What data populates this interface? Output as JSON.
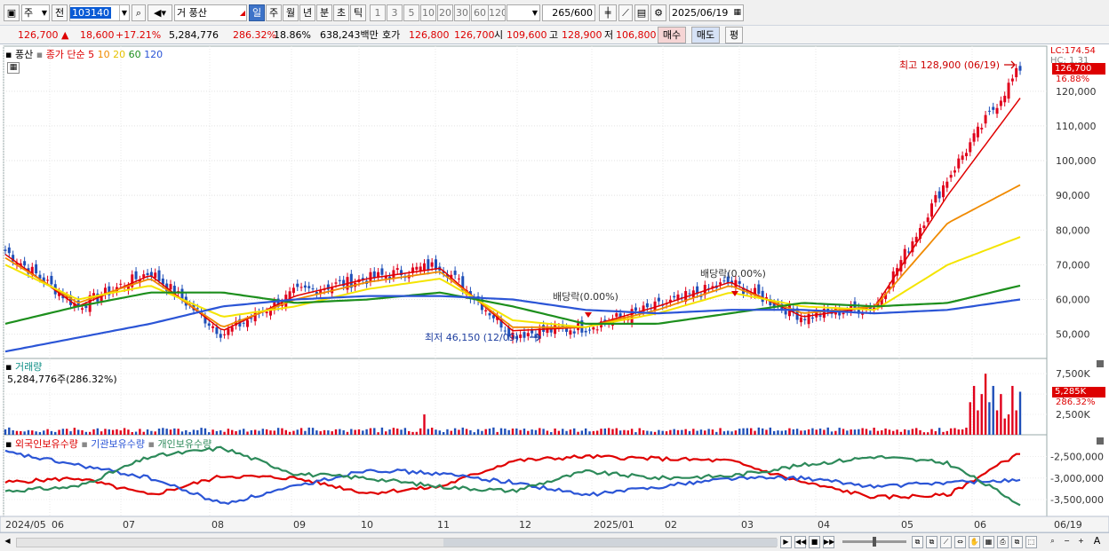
{
  "toolbar": {
    "market": "주",
    "prefix": "전",
    "code": "103140",
    "stock_name": "풍산",
    "periods": [
      "일",
      "주",
      "월",
      "년",
      "분",
      "초",
      "틱"
    ],
    "active_period": "일",
    "minutes": [
      "1",
      "3",
      "5",
      "10",
      "20",
      "30",
      "60",
      "120"
    ],
    "count": "265",
    "count_total": "/600",
    "date": "2025/06/19"
  },
  "quote": {
    "price": "126,700",
    "change": "18,600",
    "change_pct": "+17.21%",
    "volume": "5,284,776",
    "volume_pct": "286.32%",
    "turnover": "18.86%",
    "amount": "638,243백만",
    "ask_label": "호가",
    "ask": "126,800",
    "bid": "126,700",
    "open_label": "시",
    "open": "109,600",
    "high_label": "고",
    "high": "128,900",
    "low_label": "저",
    "low": "106,800",
    "buy_label": "매수",
    "sell_label": "매도",
    "eval_label": "평"
  },
  "legend": {
    "name": "풍산",
    "title": "종가 단순",
    "ma5": "5",
    "ma10": "10",
    "ma20": "20",
    "ma60": "60",
    "ma120": "120"
  },
  "colors": {
    "up": "#e0001b",
    "down": "#1f4fb8",
    "ma5": "#e00000",
    "ma10": "#f08a00",
    "ma20": "#f4e400",
    "ma60": "#1d8f1d",
    "ma120": "#2b55d6",
    "foreign": "#e00000",
    "inst": "#2b55d6",
    "indiv": "#2d8a5a"
  },
  "price_panel": {
    "lc": "LC:174.54",
    "hc": "HC: 1.31",
    "current_tag": "126,700",
    "current_pct": "16.88%",
    "high_note": "최고 128,900 (06/19)",
    "low_note": "최저 46,150 (12/09)",
    "div1": "배당락(0.00%)",
    "div2": "배당락(0.00%)"
  },
  "volume_panel": {
    "title": "거래량",
    "value": "5,284,776주(286.32%)",
    "tag": "5,285K",
    "tag_pct": "286.32%"
  },
  "holdings_panel": {
    "foreign": "외국인보유수량",
    "inst": "기관보유수량",
    "indiv": "개인보유수량"
  },
  "x_labels": [
    "2024/05",
    "06",
    "07",
    "08",
    "09",
    "10",
    "11",
    "12",
    "2025/01",
    "02",
    "03",
    "04",
    "05",
    "06",
    "06/19"
  ],
  "chart_data": [
    {
      "type": "line",
      "title": "풍산 종가 단순 이동평균",
      "x": [
        "2024/05",
        "06",
        "07",
        "08",
        "09",
        "10",
        "11",
        "12",
        "2025/01",
        "02",
        "03",
        "04",
        "05",
        "06",
        "06/19"
      ],
      "series": [
        {
          "name": "종가",
          "values": [
            74000,
            58000,
            68000,
            50000,
            62000,
            66000,
            70000,
            50000,
            52000,
            58000,
            65000,
            55000,
            58000,
            95000,
            126700
          ]
        },
        {
          "name": "5",
          "values": [
            73000,
            58000,
            67000,
            51000,
            61000,
            66000,
            69000,
            51000,
            52000,
            58000,
            65000,
            55000,
            58000,
            90000,
            118000
          ]
        },
        {
          "name": "10",
          "values": [
            72000,
            59000,
            66000,
            52000,
            60000,
            65000,
            68000,
            52000,
            52000,
            57000,
            64000,
            56000,
            58000,
            82000,
            93000
          ]
        },
        {
          "name": "20",
          "values": [
            70000,
            60000,
            64000,
            55000,
            58000,
            63000,
            66000,
            54000,
            52000,
            56000,
            62000,
            58000,
            57000,
            70000,
            78000
          ]
        },
        {
          "name": "60",
          "values": [
            53000,
            58000,
            62000,
            62000,
            59000,
            60000,
            62000,
            58000,
            53000,
            53000,
            56000,
            59000,
            58000,
            59000,
            64000
          ]
        },
        {
          "name": "120",
          "values": [
            45000,
            49000,
            53000,
            58000,
            60000,
            61000,
            61000,
            60000,
            57000,
            56000,
            57000,
            57000,
            56000,
            57000,
            60000
          ]
        }
      ],
      "ylim": [
        43000,
        128900
      ],
      "yticks": [
        "120,000",
        "110,000",
        "100,000",
        "90,000",
        "80,000",
        "70,000",
        "60,000",
        "50,000"
      ]
    },
    {
      "type": "bar",
      "title": "거래량",
      "yticks": [
        "7,500K",
        "5,000K",
        "2,500K"
      ],
      "ylim": [
        0,
        8500000
      ]
    },
    {
      "type": "line",
      "title": "보유수량",
      "series": [
        {
          "name": "외국인보유수량",
          "values": [
            -3100000,
            -3000000,
            -3400000,
            -2950000,
            -3000000,
            -3350000,
            -3200000,
            -2600000,
            -2500000,
            -2550000,
            -2600000,
            -3100000,
            -3450000,
            -3400000,
            -2400000
          ]
        },
        {
          "name": "기관보유수량",
          "values": [
            -2400000,
            -2700000,
            -3000000,
            -3600000,
            -3200000,
            -2800000,
            -2900000,
            -3100000,
            -3400000,
            -3200000,
            -3000000,
            -3000000,
            -3200000,
            -3100000,
            -3050000
          ]
        },
        {
          "name": "개인보유수량",
          "values": [
            -3300000,
            -3200000,
            -2500000,
            -2300000,
            -2900000,
            -3000000,
            -3200000,
            -3300000,
            -2850000,
            -3000000,
            -2950000,
            -2700000,
            -2500000,
            -2650000,
            -3600000
          ]
        }
      ],
      "yticks": [
        "-2,500,000",
        "-3,000,000",
        "-3,500,000"
      ],
      "ylim": [
        -3850000,
        -2200000
      ]
    }
  ]
}
